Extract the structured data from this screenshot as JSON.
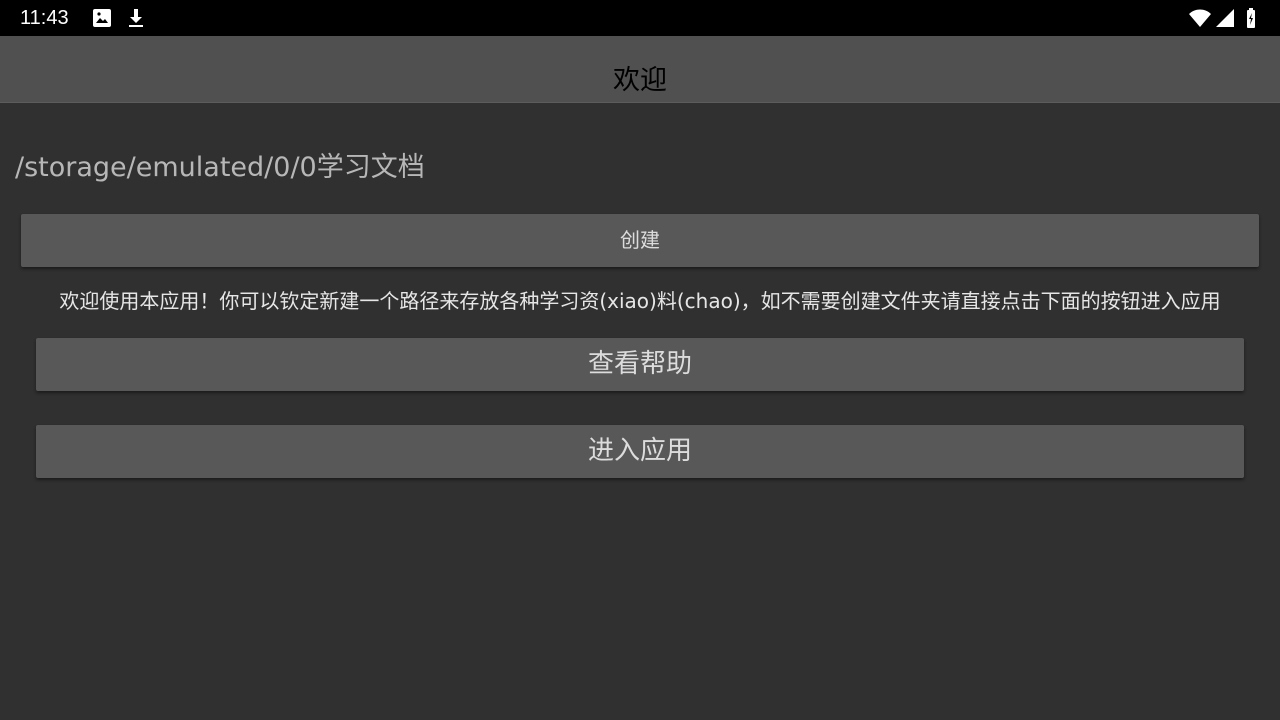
{
  "status_bar": {
    "time": "11:43",
    "icons_left": [
      "image-icon",
      "download-icon"
    ],
    "icons_right": [
      "wifi-icon",
      "cell-signal-icon",
      "battery-charging-icon"
    ]
  },
  "app_bar": {
    "title": "欢迎"
  },
  "main": {
    "path": "/storage/emulated/0/0学习文档",
    "create_button_label": "创建",
    "welcome_message": "欢迎使用本应用！你可以钦定新建一个路径来存放各种学习资(xiao)料(chao)，如不需要创建文件夹请直接点击下面的按钮进入应用",
    "help_button_label": "查看帮助",
    "enter_button_label": "进入应用"
  },
  "colors": {
    "background": "#303030",
    "app_bar": "#505050",
    "button": "#585859",
    "status_bar": "#000000"
  }
}
